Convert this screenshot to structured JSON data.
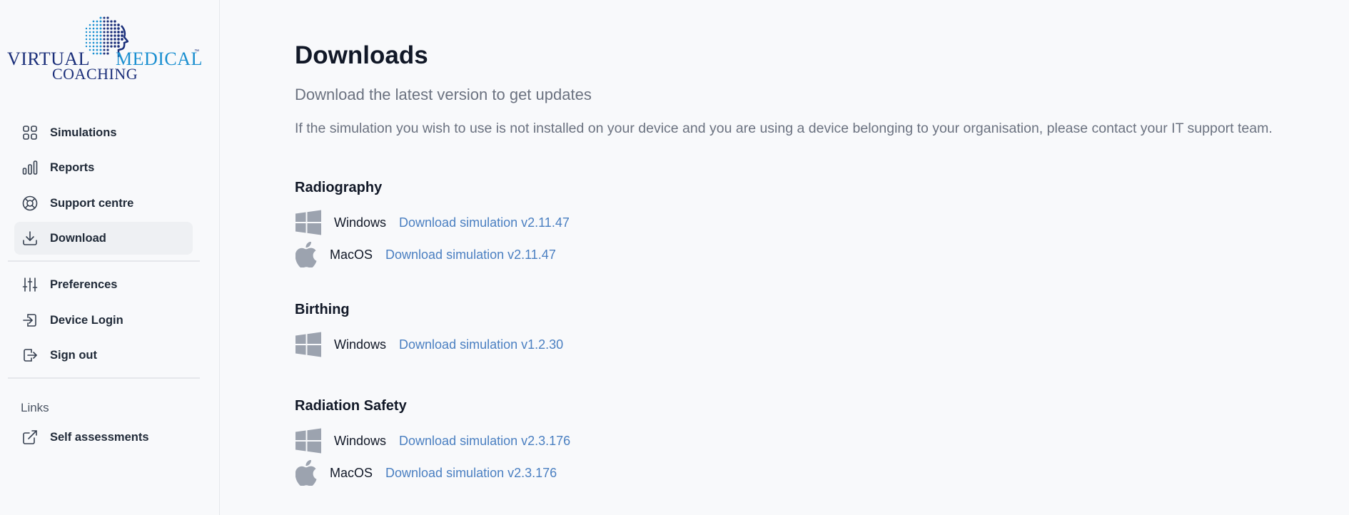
{
  "brand": {
    "line1_left": "VIRTUAL",
    "line1_right": "MEDICAL",
    "line2": "COACHING",
    "trademark": "™"
  },
  "sidebar": {
    "items": [
      {
        "label": "Simulations",
        "icon": "grid-icon"
      },
      {
        "label": "Reports",
        "icon": "bar-chart-icon"
      },
      {
        "label": "Support centre",
        "icon": "lifebuoy-icon"
      },
      {
        "label": "Download",
        "icon": "download-icon",
        "active": true
      },
      {
        "label": "Preferences",
        "icon": "sliders-icon"
      },
      {
        "label": "Device Login",
        "icon": "login-icon"
      },
      {
        "label": "Sign out",
        "icon": "logout-icon"
      }
    ],
    "links_header": "Links",
    "links": [
      {
        "label": "Self assessments",
        "icon": "external-link-icon"
      }
    ]
  },
  "main": {
    "title": "Downloads",
    "subtitle": "Download the latest version to get updates",
    "description": "If the simulation you wish to use is not installed on your device and you are using a device belonging to your organisation, please contact your IT support team.",
    "sections": [
      {
        "name": "Radiography",
        "downloads": [
          {
            "os": "Windows",
            "icon": "windows-icon",
            "link": "Download simulation v2.11.47"
          },
          {
            "os": "MacOS",
            "icon": "apple-icon",
            "link": "Download simulation v2.11.47"
          }
        ]
      },
      {
        "name": "Birthing",
        "downloads": [
          {
            "os": "Windows",
            "icon": "windows-icon",
            "link": "Download simulation v1.2.30"
          }
        ]
      },
      {
        "name": "Radiation Safety",
        "downloads": [
          {
            "os": "Windows",
            "icon": "windows-icon",
            "link": "Download simulation v2.3.176"
          },
          {
            "os": "MacOS",
            "icon": "apple-icon",
            "link": "Download simulation v2.3.176"
          }
        ]
      }
    ]
  },
  "colors": {
    "link": "#4a7fc1",
    "brand_dark": "#1b2f7a",
    "brand_light": "#1a8fd0",
    "os_icon": "#9ca3af",
    "active_nav_bg": "#eef0f3"
  }
}
